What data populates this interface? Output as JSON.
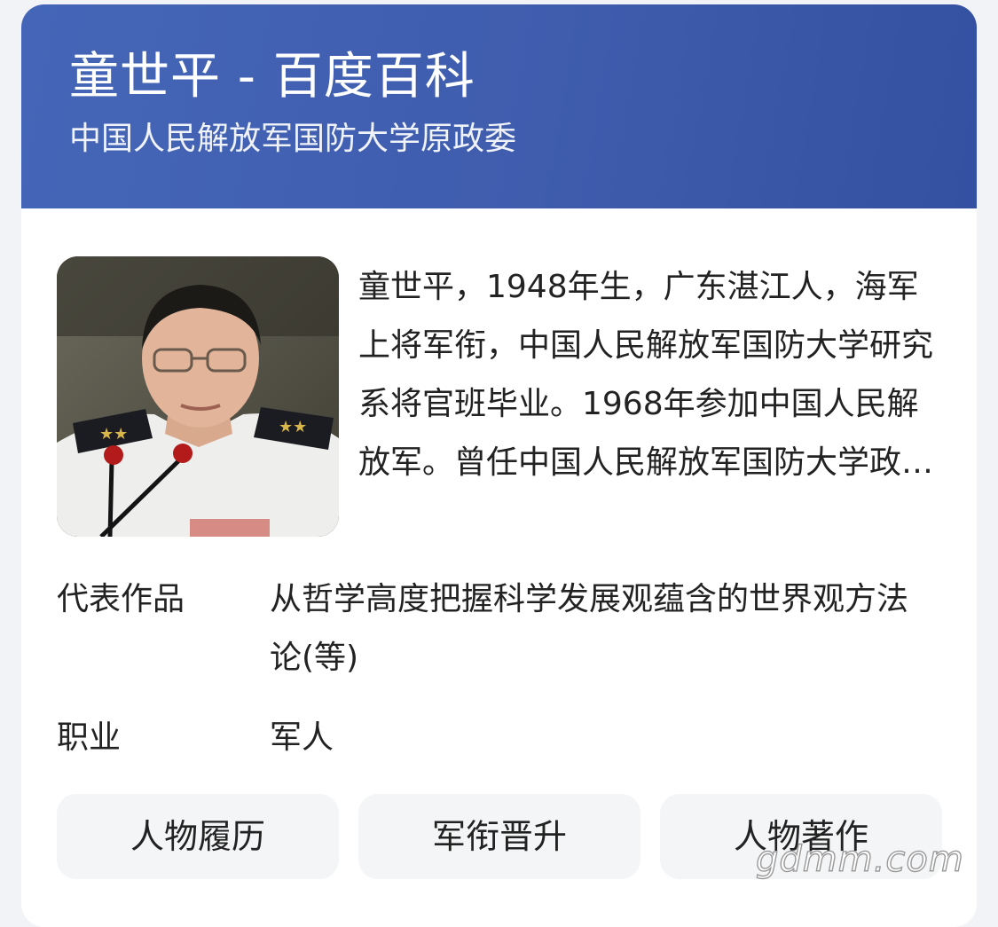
{
  "header": {
    "title": "童世平 - 百度百科",
    "subtitle": "中国人民解放军国防大学原政委"
  },
  "intro": {
    "portrait_icon": "person-photo",
    "summary": "童世平，1948年生，广东湛江人，海军上将军衔，中国人民解放军国防大学研究系将官班毕业。1968年参加中国人民解放军。曾任中国人民解放军国防大学政治委员"
  },
  "info": [
    {
      "label": "代表作品",
      "value": "从哲学高度把握科学发展观蕴含的世界观方法论(等)"
    },
    {
      "label": "职业",
      "value": "军人"
    }
  ],
  "tabs": [
    {
      "label": "人物履历"
    },
    {
      "label": "军衔晋升"
    },
    {
      "label": "人物著作"
    }
  ],
  "watermark": "gdmm.com",
  "colors": {
    "header_gradient_start": "#4566b8",
    "header_gradient_end": "#3450a0",
    "card_background": "#ffffff",
    "tab_background": "#f4f5f7",
    "text": "#222222"
  }
}
